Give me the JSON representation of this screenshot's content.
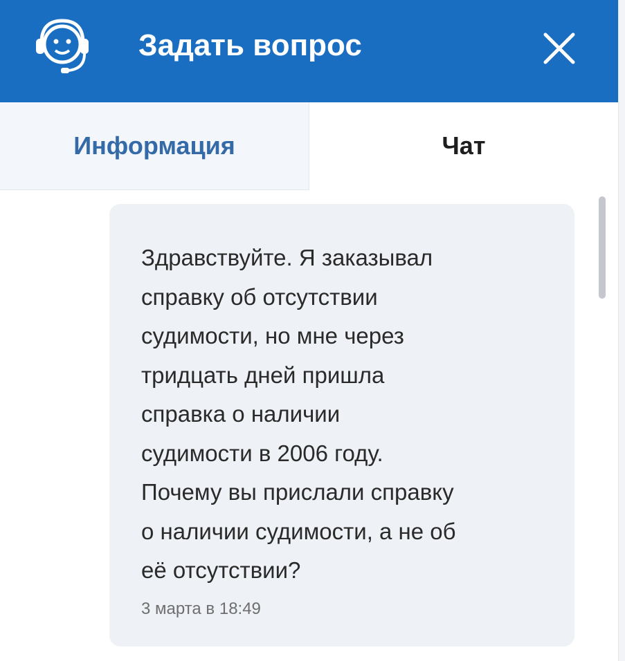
{
  "header": {
    "title": "Задать вопрос",
    "icons": {
      "support": "headset-operator-icon",
      "close": "close-icon"
    }
  },
  "tabs": [
    {
      "label": "Информация",
      "active": false
    },
    {
      "label": "Чат",
      "active": true
    }
  ],
  "chat": {
    "messages": [
      {
        "lines": [
          "Здравствуйте. Я заказывал",
          "справку об отсутствии",
          "судимости, но мне через",
          "тридцать дней пришла",
          "справка о наличии",
          "судимости в 2006 году.",
          "Почему вы прислали справку",
          "о наличии судимости, а не об",
          "её отсутствии?"
        ],
        "time": "3 марта в 18:49"
      }
    ]
  },
  "colors": {
    "header_bg": "#1a6ec2",
    "header_text": "#ffffff",
    "inactive_tab_text": "#356aa8",
    "bubble_bg": "#eef1f5"
  }
}
